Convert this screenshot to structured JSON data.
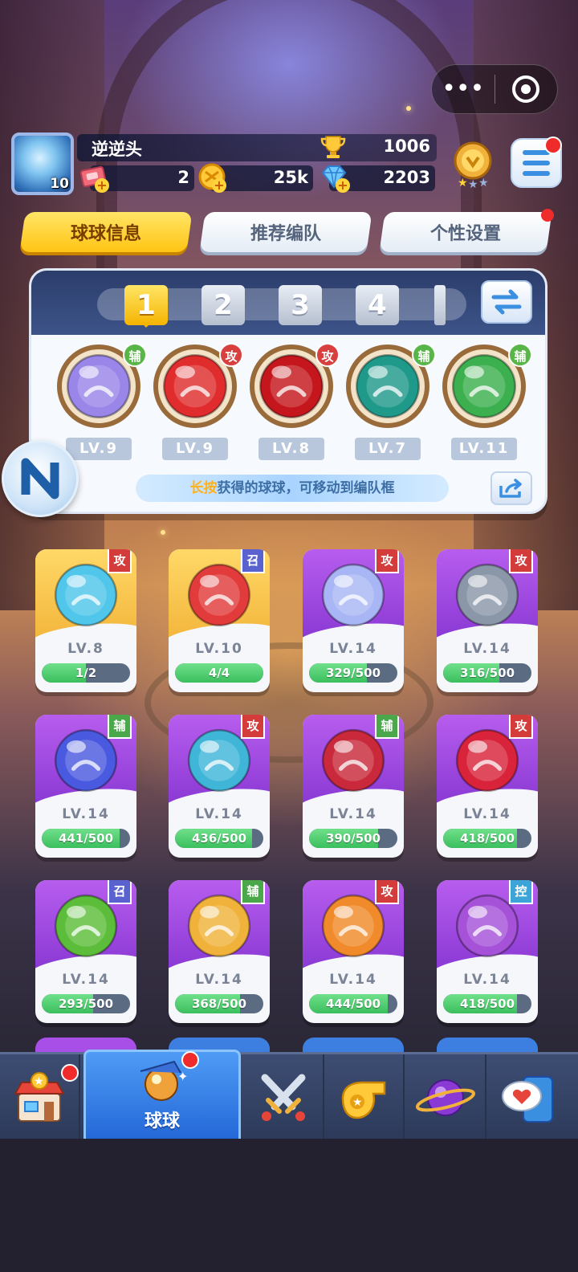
{
  "player": {
    "name": "逆逆头",
    "avatar_level": "10",
    "trophies": "1006",
    "tickets": "2",
    "coins": "25k",
    "gems": "2203"
  },
  "tabs": [
    {
      "label": "球球信息",
      "active": true
    },
    {
      "label": "推荐编队",
      "active": false
    },
    {
      "label": "个性设置",
      "active": false,
      "badge": true
    }
  ],
  "team": {
    "slots": [
      "1",
      "2",
      "3",
      "4"
    ],
    "active_slot": "1",
    "balls": [
      {
        "icon": "people-ball-icon",
        "role": "辅",
        "level": "LV.9",
        "color": "#9a86e8"
      },
      {
        "icon": "venom-ball-icon",
        "role": "攻",
        "level": "LV.9",
        "color": "#e02c2c"
      },
      {
        "icon": "trident-ball-icon",
        "role": "攻",
        "level": "LV.8",
        "color": "#c4161c"
      },
      {
        "icon": "dragon-ball-icon",
        "role": "辅",
        "level": "LV.7",
        "color": "#1f9a8a"
      },
      {
        "icon": "arrow-up-ball-icon",
        "role": "辅",
        "level": "LV.11",
        "color": "#3cb04e"
      }
    ],
    "hint_highlight": "长按",
    "hint_text": "获得的球球，可移动到编队框"
  },
  "cards": [
    {
      "icon": "ice-crystal-ball-icon",
      "role": "攻",
      "level": "LV.8",
      "progress": "1/2",
      "fraction": 0.5,
      "style": "gold",
      "color": "#4fc6ea"
    },
    {
      "icon": "cannon-ball-icon",
      "role": "召",
      "level": "LV.10",
      "progress": "4/4",
      "fraction": 1.0,
      "style": "gold",
      "color": "#e23b3b"
    },
    {
      "icon": "moon-ball-icon",
      "role": "攻",
      "level": "LV.14",
      "progress": "329/500",
      "fraction": 0.658,
      "style": "purple",
      "color": "#a9b6f5"
    },
    {
      "icon": "vortex-ball-icon",
      "role": "攻",
      "level": "LV.14",
      "progress": "316/500",
      "fraction": 0.632,
      "style": "purple",
      "color": "#8a97a8"
    },
    {
      "icon": "swap-arrows-ball-icon",
      "role": "辅",
      "level": "LV.14",
      "progress": "441/500",
      "fraction": 0.882,
      "style": "purple",
      "color": "#4a5ae0"
    },
    {
      "icon": "whirlpool-ball-icon",
      "role": "攻",
      "level": "LV.14",
      "progress": "436/500",
      "fraction": 0.872,
      "style": "purple",
      "color": "#3fb6d8"
    },
    {
      "icon": "fangs-ball-icon",
      "role": "辅",
      "level": "LV.14",
      "progress": "390/500",
      "fraction": 0.78,
      "style": "purple",
      "color": "#c9293a"
    },
    {
      "icon": "lightning-ball-icon",
      "role": "攻",
      "level": "LV.14",
      "progress": "418/500",
      "fraction": 0.836,
      "style": "purple",
      "color": "#d8233a"
    },
    {
      "icon": "radiation-ball-icon",
      "role": "召",
      "level": "LV.14",
      "progress": "293/500",
      "fraction": 0.586,
      "style": "purple",
      "color": "#5cbd3a"
    },
    {
      "icon": "pumpkin-ball-icon",
      "role": "辅",
      "level": "LV.14",
      "progress": "368/500",
      "fraction": 0.736,
      "style": "purple",
      "color": "#f0b23a"
    },
    {
      "icon": "staff-ball-icon",
      "role": "攻",
      "level": "LV.14",
      "progress": "444/500",
      "fraction": 0.888,
      "style": "purple",
      "color": "#f08a2a"
    },
    {
      "icon": "cloud-ball-icon",
      "role": "控",
      "level": "LV.14",
      "progress": "418/500",
      "fraction": 0.836,
      "style": "purple",
      "color": "#a552d8"
    }
  ],
  "nav": [
    {
      "icon": "shop-icon",
      "badge": true
    },
    {
      "icon": "balls-icon",
      "label": "球球",
      "active": true,
      "badge": true
    },
    {
      "icon": "crossed-swords-icon"
    },
    {
      "icon": "whistle-icon"
    },
    {
      "icon": "planet-icon"
    },
    {
      "icon": "chat-heart-icon"
    }
  ],
  "colors": {
    "active_tab": "#ffc414",
    "card_purple": "#8a39d4",
    "card_gold": "#f3b63c",
    "progress_green": "#3bbf5e",
    "nav_active": "#2468d8"
  }
}
